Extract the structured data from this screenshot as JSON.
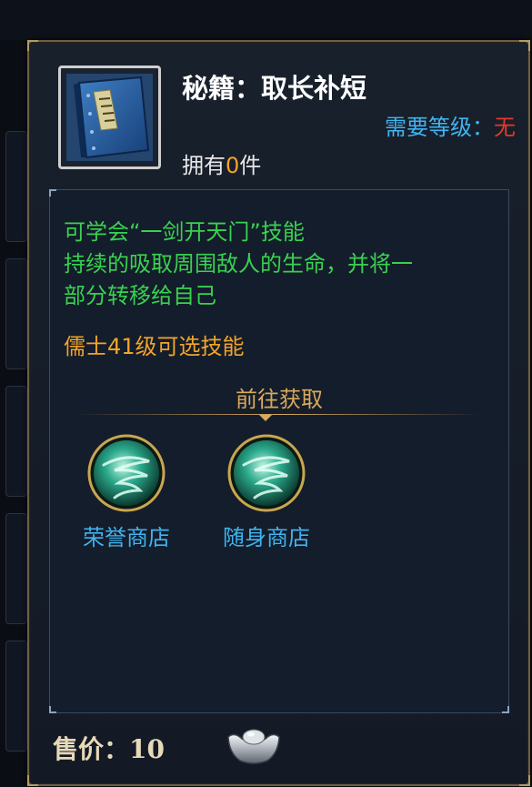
{
  "item": {
    "title": "秘籍：取长补短",
    "level_label": "需要等级：",
    "level_value": "无",
    "own_prefix": "拥有",
    "own_count": "0",
    "own_suffix": "件",
    "icon": "skill-book-icon"
  },
  "description": {
    "line1": "可学会“一剑开天门”技能",
    "line2": "持续的吸取周围敌人的生命，并将一",
    "line3": "部分转移给自己",
    "requirement": "儒士41级可选技能"
  },
  "acquire": {
    "heading": "前往获取",
    "sources": [
      {
        "label": "荣誉商店",
        "icon": "whirlwind-icon"
      },
      {
        "label": "随身商店",
        "icon": "whirlwind-icon"
      }
    ]
  },
  "price": {
    "label": "售价：",
    "value": "10",
    "currency_icon": "silver-ingot-icon"
  },
  "colors": {
    "green_text": "#39d150",
    "orange_text": "#f2a428",
    "blue_text": "#3fb4f0",
    "red_text": "#e43a2a"
  }
}
